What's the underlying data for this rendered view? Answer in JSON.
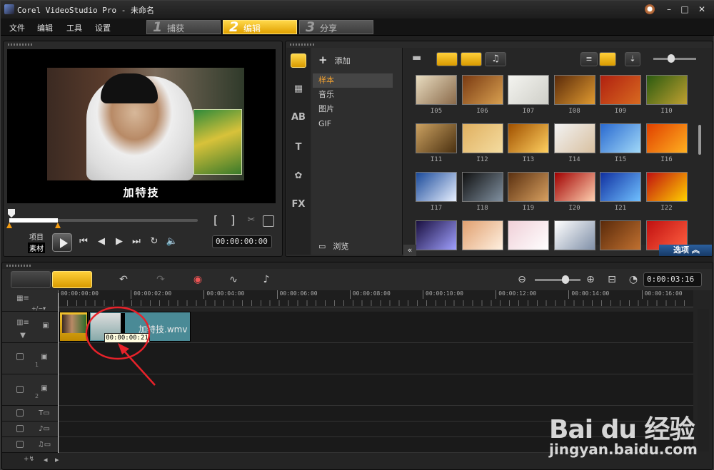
{
  "window": {
    "title": "Corel VideoStudio Pro - 未命名"
  },
  "menu": [
    "文件",
    "编辑",
    "工具",
    "设置"
  ],
  "steps": [
    {
      "num": "1",
      "label": "捕获"
    },
    {
      "num": "2",
      "label": "编辑",
      "active": true
    },
    {
      "num": "3",
      "label": "分享"
    }
  ],
  "preview": {
    "subtitle": "加特技",
    "mode_project": "项目",
    "mode_clip": "素材",
    "timecode": "00:00:00:00",
    "trim_open": "[",
    "trim_close": "]"
  },
  "library": {
    "add_label": "添加",
    "folders": [
      "样本",
      "音乐",
      "图片",
      "GIF"
    ],
    "selected_folder": "样本",
    "browse_label": "浏览",
    "options_label": "选项",
    "thumbnails": [
      {
        "label": "I05",
        "colors": [
          "#e8dcc0",
          "#8a6a4a"
        ]
      },
      {
        "label": "I06",
        "colors": [
          "#7a3a12",
          "#d8a050"
        ]
      },
      {
        "label": "I07",
        "colors": [
          "#f4f4f0",
          "#cfcfc8"
        ]
      },
      {
        "label": "I08",
        "colors": [
          "#5a2a0a",
          "#e09a30"
        ]
      },
      {
        "label": "I09",
        "colors": [
          "#b02010",
          "#d86a20"
        ]
      },
      {
        "label": "I10",
        "colors": [
          "#2a5a10",
          "#c0a030"
        ]
      },
      {
        "label": "I11",
        "colors": [
          "#caa060",
          "#4a3010"
        ]
      },
      {
        "label": "I12",
        "colors": [
          "#e0b060",
          "#f4dca0"
        ]
      },
      {
        "label": "I13",
        "colors": [
          "#a05000",
          "#ffd060"
        ]
      },
      {
        "label": "I14",
        "colors": [
          "#f2f2f2",
          "#d8c0a0"
        ]
      },
      {
        "label": "I15",
        "colors": [
          "#2a6ad0",
          "#a0d8f8"
        ]
      },
      {
        "label": "I16",
        "colors": [
          "#e04000",
          "#ffb020"
        ]
      },
      {
        "label": "I17",
        "colors": [
          "#1a4a9a",
          "#e8f0ff"
        ]
      },
      {
        "label": "I18",
        "colors": [
          "#101010",
          "#8090a0"
        ]
      },
      {
        "label": "I19",
        "colors": [
          "#5a3010",
          "#d8a060"
        ]
      },
      {
        "label": "I20",
        "colors": [
          "#a00000",
          "#ffd0b0"
        ]
      },
      {
        "label": "I21",
        "colors": [
          "#1030a0",
          "#70c0ff"
        ]
      },
      {
        "label": "I22",
        "colors": [
          "#c01010",
          "#ffd000"
        ]
      },
      {
        "label": "",
        "colors": [
          "#1a1040",
          "#a0a0ff"
        ]
      },
      {
        "label": "",
        "colors": [
          "#e0a070",
          "#fff0e0"
        ]
      },
      {
        "label": "",
        "colors": [
          "#f0d0d8",
          "#fff"
        ]
      },
      {
        "label": "",
        "colors": [
          "#ffffff",
          "#8090a8"
        ]
      },
      {
        "label": "",
        "colors": [
          "#5a2a0a",
          "#c07030"
        ]
      },
      {
        "label": "",
        "colors": [
          "#c01010",
          "#ff6040"
        ]
      }
    ]
  },
  "timeline": {
    "duration": "0:00:03:16",
    "ruler": [
      "00:00:00:00",
      "00:00:02:00",
      "00:00:04:00",
      "00:00:06:00",
      "00:00:08:00",
      "00:00:10:00",
      "00:00:12:00",
      "00:00:14:00",
      "00:00:16:00"
    ],
    "clip_name": "加特技.wmv",
    "tooltip": "00:00:00:21",
    "track_labels": [
      "1",
      "2",
      "1",
      "1",
      "1"
    ]
  },
  "watermark": {
    "brand": "Bai du 经验",
    "url": "jingyan.baidu.com"
  }
}
